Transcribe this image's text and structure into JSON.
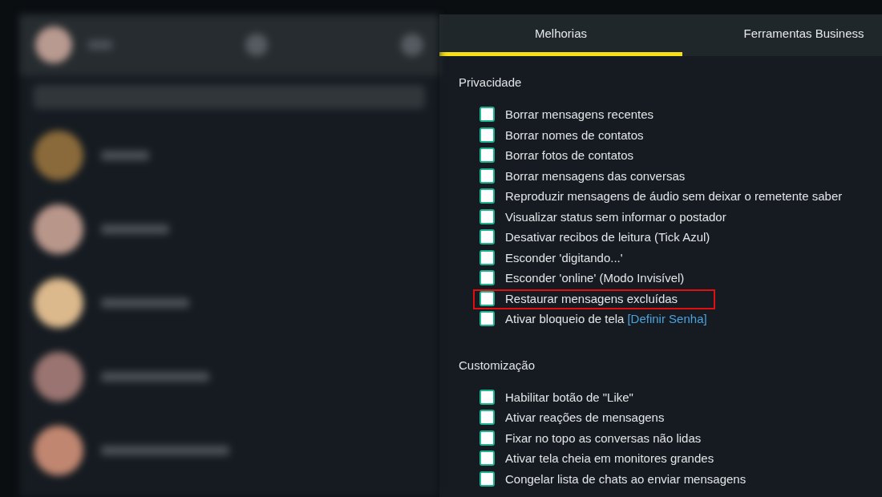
{
  "tabs": [
    {
      "label": "Melhorias",
      "selected": true
    },
    {
      "label": "Ferramentas Business",
      "selected": false
    }
  ],
  "sections": [
    {
      "title": "Privacidade",
      "items": [
        {
          "label": "Borrar mensagens recentes",
          "checked": false,
          "highlighted": false
        },
        {
          "label": "Borrar nomes de contatos",
          "checked": false,
          "highlighted": false
        },
        {
          "label": "Borrar fotos de contatos",
          "checked": false,
          "highlighted": false
        },
        {
          "label": "Borrar mensagens das conversas",
          "checked": false,
          "highlighted": false
        },
        {
          "label": "Reproduzir mensagens de áudio sem deixar o remetente saber",
          "checked": false,
          "highlighted": false
        },
        {
          "label": "Visualizar status sem informar o postador",
          "checked": false,
          "highlighted": false
        },
        {
          "label": "Desativar recibos de leitura (Tick Azul)",
          "checked": false,
          "highlighted": false
        },
        {
          "label": "Esconder 'digitando...'",
          "checked": false,
          "highlighted": false
        },
        {
          "label": "Esconder 'online' (Modo Invisível)",
          "checked": false,
          "highlighted": false
        },
        {
          "label": "Restaurar mensagens excluídas",
          "checked": false,
          "highlighted": true
        },
        {
          "label": "Ativar bloqueio de tela",
          "link": "[Definir Senha]",
          "checked": false,
          "highlighted": false
        }
      ]
    },
    {
      "title": "Customização",
      "items": [
        {
          "label": "Habilitar botão de \"Like\"",
          "checked": false,
          "highlighted": false
        },
        {
          "label": "Ativar reações de mensagens",
          "checked": false,
          "highlighted": false
        },
        {
          "label": "Fixar no topo as conversas não lidas",
          "checked": false,
          "highlighted": false
        },
        {
          "label": "Ativar tela cheia em monitores grandes",
          "checked": false,
          "highlighted": false
        },
        {
          "label": "Congelar lista de chats ao enviar mensagens",
          "checked": false,
          "highlighted": false
        }
      ]
    }
  ]
}
